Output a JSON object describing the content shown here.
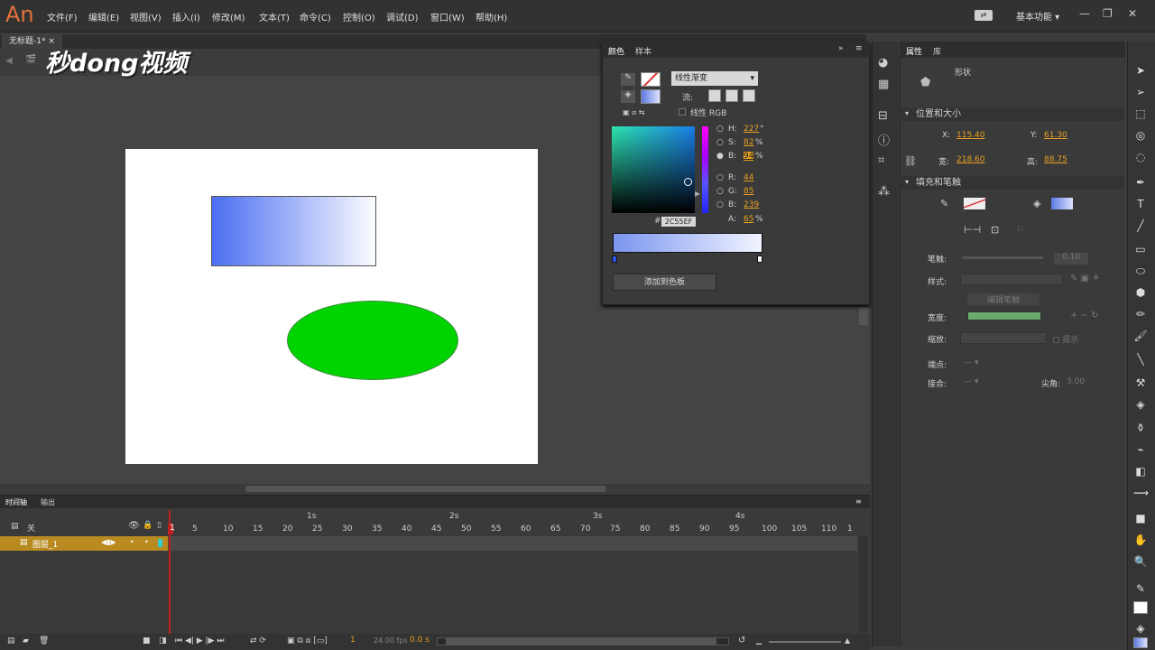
{
  "app": {
    "logo": "An",
    "menus": [
      "文件(F)",
      "编辑(E)",
      "视图(V)",
      "插入(I)",
      "修改(M)",
      "文本(T)",
      "命令(C)",
      "控制(O)",
      "调试(D)",
      "窗口(W)",
      "帮助(H)"
    ],
    "workspace": "基本功能"
  },
  "document": {
    "tab": "无标题-1*"
  },
  "watermark": "秒dong视频",
  "color_panel": {
    "tabs": [
      "颜色",
      "样本"
    ],
    "fill_type": "线性渐变",
    "flow_label": "流:",
    "linear_rgb": "线性 RGB",
    "fields": [
      {
        "label": "H:",
        "value": "227",
        "unit": "°"
      },
      {
        "label": "S:",
        "value": "82",
        "unit": "%"
      },
      {
        "label": "B:",
        "value": "94",
        "unit": "%"
      },
      {
        "label": "R:",
        "value": "44",
        "unit": ""
      },
      {
        "label": "G:",
        "value": "85",
        "unit": ""
      },
      {
        "label": "B:",
        "value": "239",
        "unit": ""
      },
      {
        "label": "A:",
        "value": "65",
        "unit": "%"
      }
    ],
    "hex_label": "#",
    "hex": "2C55EF",
    "add_button": "添加到色板"
  },
  "properties": {
    "tabs": [
      "属性",
      "库"
    ],
    "object_type": "形状",
    "pos_section": "位置和大小",
    "x_label": "X:",
    "x": "115.40",
    "y_label": "Y:",
    "y": "61.30",
    "w_label": "宽:",
    "w": "218.60",
    "h_label": "高:",
    "h": "88.75",
    "fill_section": "填充和笔触",
    "stroke_label": "笔触:",
    "stroke_value": "0.10",
    "style_label": "样式:",
    "edit_stroke": "编辑笔触",
    "width_label": "宽度:",
    "scale_label": "缩放:",
    "hint_label": "提示",
    "cap_label": "端点:",
    "join_label": "接合:",
    "miter_label": "尖角:",
    "miter_value": "3.00"
  },
  "timeline": {
    "tabs": [
      "时间轴",
      "输出"
    ],
    "header_label": "关",
    "layer_name": "图层_1",
    "seconds": [
      "1s",
      "2s",
      "3s",
      "4s"
    ],
    "frames": [
      "1",
      "5",
      "10",
      "15",
      "20",
      "25",
      "30",
      "35",
      "40",
      "45",
      "50",
      "55",
      "60",
      "65",
      "70",
      "75",
      "80",
      "85",
      "90",
      "95",
      "100",
      "105",
      "110",
      "1"
    ],
    "current_frame": "1",
    "fps": "24.00 fps",
    "time": "0.0 s"
  }
}
